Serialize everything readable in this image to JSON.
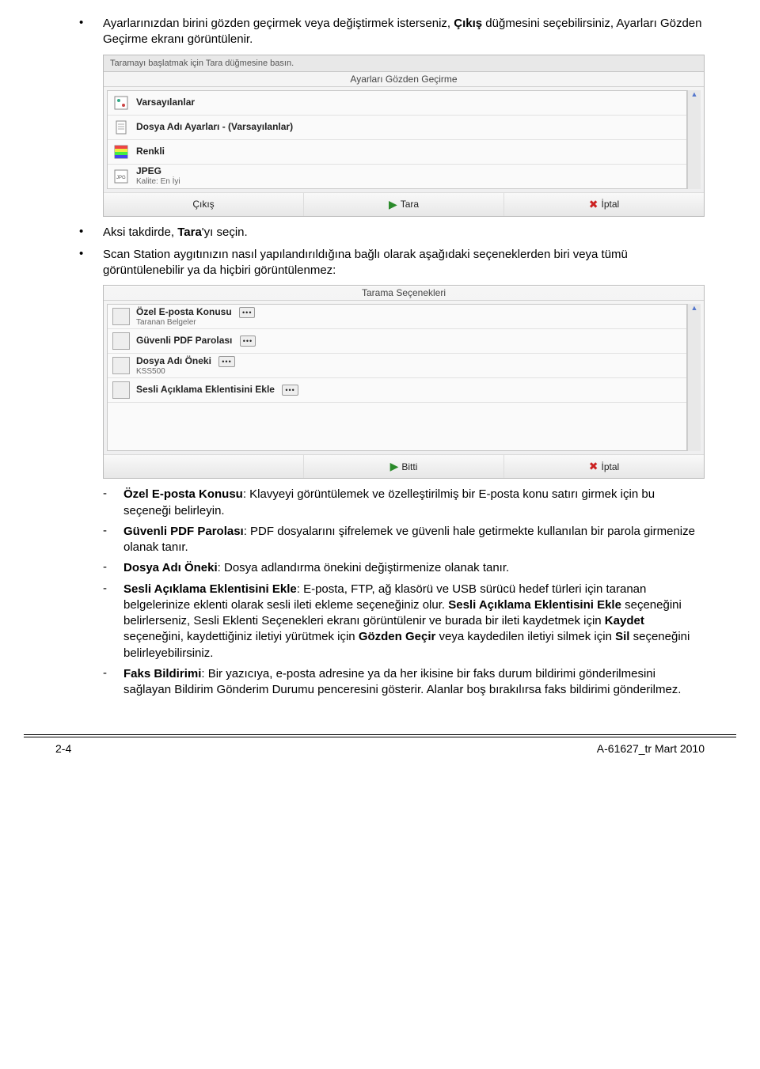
{
  "intro_bullets": [
    {
      "pre": "Ayarlarınızdan birini gözden geçirmek veya değiştirmek isterseniz, ",
      "b1": "Çıkış",
      "mid": " düğmesini seçebilirsiniz, Ayarları Gözden Geçirme ekranı görüntülenir."
    }
  ],
  "shot1": {
    "topbar": "Taramayı başlatmak için Tara düğmesine basın.",
    "header": "Ayarları Gözden Geçirme",
    "rows": [
      {
        "main": "Varsayılanlar",
        "sub": ""
      },
      {
        "main": "Dosya Adı Ayarları - (Varsayılanlar)",
        "sub": ""
      },
      {
        "main": "Renkli",
        "sub": ""
      },
      {
        "main": "JPEG",
        "sub": "Kalite: En İyi"
      }
    ],
    "buttons": {
      "left": "Çıkış",
      "mid": "Tara",
      "right": "İptal"
    }
  },
  "mid_bullets": [
    {
      "pre": "Aksi takdirde, ",
      "b1": "Tara",
      "post": "'yı seçin."
    },
    {
      "full": "Scan Station aygıtınızın nasıl yapılandırıldığına bağlı olarak aşağıdaki seçeneklerden biri veya tümü görüntülenebilir ya da hiçbiri görüntülenmez:"
    }
  ],
  "shot2": {
    "header": "Tarama Seçenekleri",
    "rows": [
      {
        "main": "Özel E-posta Konusu",
        "sub": "Taranan Belgeler",
        "dots": true
      },
      {
        "main": "Güvenli PDF Parolası",
        "sub": "",
        "dots": true
      },
      {
        "main": "Dosya Adı Öneki",
        "sub": "KSS500",
        "dots": true
      },
      {
        "main": "Sesli Açıklama Eklentisini Ekle",
        "sub": "",
        "dots": true
      }
    ],
    "buttons": {
      "left": "",
      "mid": "Bitti",
      "right": "İptal"
    }
  },
  "sub_items": [
    {
      "b": "Özel E-posta Konusu",
      "text": ": Klavyeyi görüntülemek ve özelleştirilmiş bir E-posta konu satırı girmek için bu seçeneği belirleyin."
    },
    {
      "b": "Güvenli PDF Parolası",
      "text": ": PDF dosyalarını şifrelemek ve güvenli hale getirmekte kullanılan bir parola girmenize olanak tanır."
    },
    {
      "b": "Dosya Adı Öneki",
      "text": ": Dosya adlandırma önekini değiştirmenize olanak tanır."
    },
    {
      "b": "Sesli Açıklama Eklentisini Ekle",
      "text": ": E-posta, FTP, ağ klasörü ve USB sürücü hedef türleri için taranan belgelerinize eklenti olarak sesli ileti ekleme seçeneğiniz olur. ",
      "b2": "Sesli Açıklama Eklentisini Ekle",
      "text2": " seçeneğini belirlerseniz, Sesli Eklenti Seçenekleri ekranı görüntülenir ve burada bir ileti kaydetmek için ",
      "b3": "Kaydet",
      "text3": " seçeneğini, kaydettiğiniz iletiyi yürütmek için ",
      "b4": "Gözden Geçir",
      "text4": " veya kaydedilen iletiyi silmek için ",
      "b5": "Sil",
      "text5": " seçeneğini belirleyebilirsiniz."
    },
    {
      "b": "Faks Bildirimi",
      "text": ": Bir yazıcıya, e-posta adresine ya da her ikisine bir faks durum bildirimi gönderilmesini sağlayan Bildirim Gönderim Durumu penceresini gösterir. Alanlar boş bırakılırsa faks bildirimi gönderilmez."
    }
  ],
  "footer": {
    "left": "2-4",
    "right": "A-61627_tr  Mart 2010"
  }
}
